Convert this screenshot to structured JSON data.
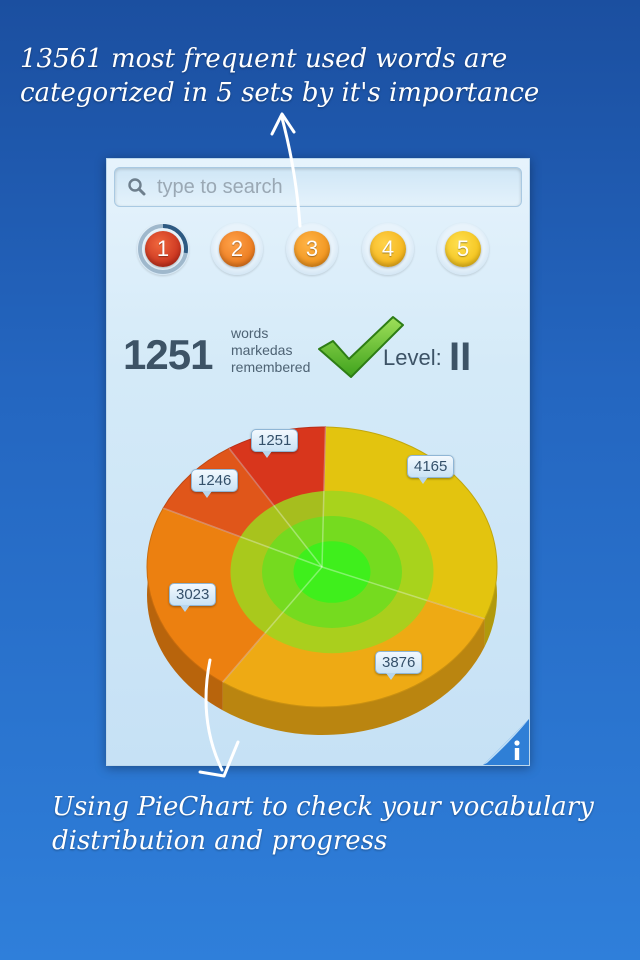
{
  "captions": {
    "top": "13561 most frequent used words are categorized in 5 sets by it's importance",
    "bottom": "Using PieChart to check your vocabulary distribution and progress"
  },
  "search": {
    "placeholder": "type to search",
    "value": ""
  },
  "levels": [
    {
      "label": "1",
      "color": "#d63a1e",
      "selected": true
    },
    {
      "label": "2",
      "color": "#ee7a12"
    },
    {
      "label": "3",
      "color": "#f29410"
    },
    {
      "label": "4",
      "color": "#f6b90e"
    },
    {
      "label": "5",
      "color": "#f5c40c"
    }
  ],
  "stats": {
    "count": "1251",
    "label_line1": "words",
    "label_line2": "markedas",
    "label_line3": "remembered",
    "level_label": "Level:",
    "level_value": "II"
  },
  "chart_data": {
    "type": "pie",
    "slices": [
      {
        "label": "4165",
        "value": 4165,
        "color": "#e3c40f"
      },
      {
        "label": "3876",
        "value": 3876,
        "color": "#eeaa14"
      },
      {
        "label": "3023",
        "value": 3023,
        "color": "#ec8010"
      },
      {
        "label": "1246",
        "value": 1246,
        "color": "#e0561a"
      },
      {
        "label": "1251",
        "value": 1251,
        "color": "#d8361c"
      }
    ]
  },
  "icons": {
    "search": "search-icon",
    "check": "check-icon",
    "info": "info-icon"
  }
}
